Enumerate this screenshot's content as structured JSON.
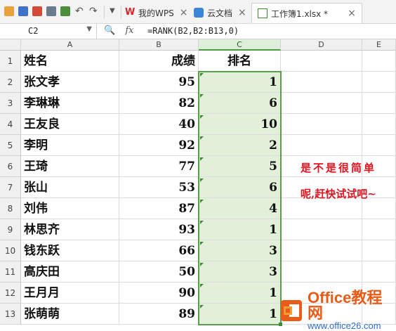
{
  "tabs": [
    {
      "label": "我的WPS",
      "icon": "wps-logo-icon"
    },
    {
      "label": "云文档",
      "icon": "cloud-doc-icon"
    },
    {
      "label": "工作簿1.xlsx *",
      "icon": "spreadsheet-icon",
      "active": true
    }
  ],
  "formula_bar": {
    "cell_ref": "C2",
    "fx_label": "fx",
    "formula": "=RANK(B2,B2:B13,0)"
  },
  "columns": [
    "A",
    "B",
    "C",
    "D",
    "E"
  ],
  "selected_column": "C",
  "rows": [
    {
      "num": "1",
      "name": "姓名",
      "score": "成绩",
      "rank": "排名",
      "header": true
    },
    {
      "num": "2",
      "name": "张文孝",
      "score": "95",
      "rank": "1"
    },
    {
      "num": "3",
      "name": "李琳琳",
      "score": "82",
      "rank": "6"
    },
    {
      "num": "4",
      "name": "王友良",
      "score": "40",
      "rank": "10"
    },
    {
      "num": "5",
      "name": "李明",
      "score": "92",
      "rank": "2"
    },
    {
      "num": "6",
      "name": "王琦",
      "score": "77",
      "rank": "5"
    },
    {
      "num": "7",
      "name": "张山",
      "score": "53",
      "rank": "6"
    },
    {
      "num": "8",
      "name": "刘伟",
      "score": "87",
      "rank": "4"
    },
    {
      "num": "9",
      "name": "林思齐",
      "score": "93",
      "rank": "1"
    },
    {
      "num": "10",
      "name": "钱东跃",
      "score": "66",
      "rank": "3"
    },
    {
      "num": "11",
      "name": "高庆田",
      "score": "50",
      "rank": "3"
    },
    {
      "num": "12",
      "name": "王月月",
      "score": "90",
      "rank": "1"
    },
    {
      "num": "13",
      "name": "张萌萌",
      "score": "89",
      "rank": "1"
    }
  ],
  "annotation": {
    "line1": "是不是很简单",
    "line2": "呢,赶快试试吧~"
  },
  "watermark": {
    "main": "Office教程网",
    "sub": "www.office26.com"
  },
  "colors": {
    "selection": "#5a9e4c",
    "selected_fill": "#e2f0d9",
    "annotation": "#e0141e",
    "logo_orange": "#e85c17"
  }
}
